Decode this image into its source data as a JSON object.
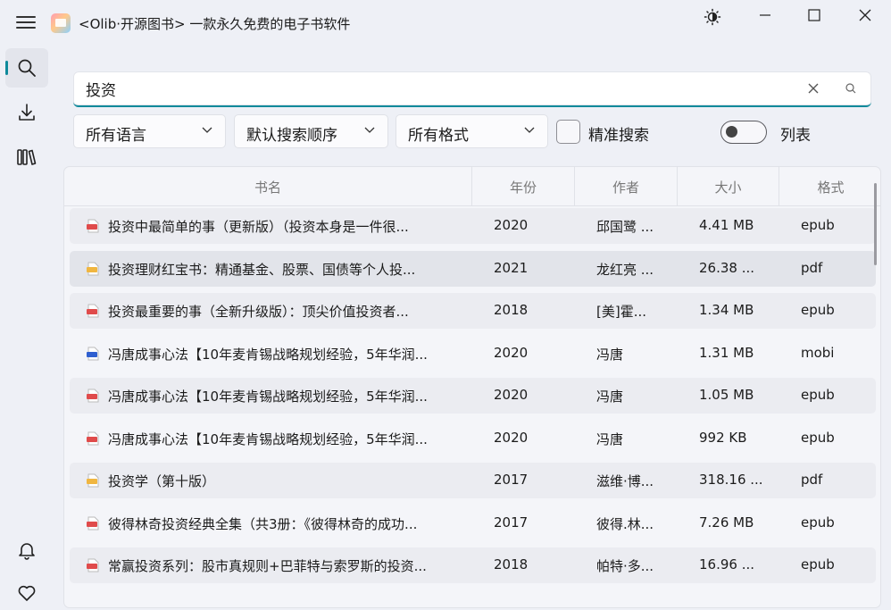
{
  "app": {
    "title": "<Olib·开源图书> 一款永久免费的电子书软件"
  },
  "search": {
    "query": "投资"
  },
  "filters": {
    "language": "所有语言",
    "order": "默认搜索顺序",
    "format": "所有格式",
    "exact_label": "精准搜索",
    "list_label": "列表",
    "exact_checked": false,
    "list_on": false
  },
  "table": {
    "headers": {
      "title": "书名",
      "year": "年份",
      "author": "作者",
      "size": "大小",
      "format": "格式"
    },
    "rows": [
      {
        "title": "投资中最简单的事（更新版）（投资本身是一件很...",
        "year": "2020",
        "author": "邱国鹭 ...",
        "size": "4.41 MB",
        "format": "epub",
        "icon": "epub-file-icon"
      },
      {
        "title": "投资理财红宝书：精通基金、股票、国债等个人投...",
        "year": "2021",
        "author": "龙红亮 ...",
        "size": "26.38 ...",
        "format": "pdf",
        "icon": "pdf-file-icon"
      },
      {
        "title": "投资最重要的事（全新升级版）：顶尖价值投资者...",
        "year": "2018",
        "author": "[美]霍...",
        "size": "1.34 MB",
        "format": "epub",
        "icon": "epub-file-icon"
      },
      {
        "title": "冯唐成事心法【10年麦肯锡战略规划经验，5年华润...",
        "year": "2020",
        "author": "冯唐",
        "size": "1.31 MB",
        "format": "mobi",
        "icon": "mobi-file-icon"
      },
      {
        "title": "冯唐成事心法【10年麦肯锡战略规划经验，5年华润...",
        "year": "2020",
        "author": "冯唐",
        "size": "1.05 MB",
        "format": "epub",
        "icon": "epub-file-icon"
      },
      {
        "title": "冯唐成事心法【10年麦肯锡战略规划经验，5年华润...",
        "year": "2020",
        "author": "冯唐",
        "size": "992 KB",
        "format": "epub",
        "icon": "epub-file-icon"
      },
      {
        "title": "投资学（第十版）",
        "year": "2017",
        "author": "滋维·博...",
        "size": "318.16 ...",
        "format": "pdf",
        "icon": "pdf-file-icon"
      },
      {
        "title": "彼得林奇投资经典全集（共3册：《彼得林奇的成功...",
        "year": "2017",
        "author": "彼得.林...",
        "size": "7.26 MB",
        "format": "epub",
        "icon": "epub-file-icon"
      },
      {
        "title": "常赢投资系列：股市真规则+巴菲特与索罗斯的投资...",
        "year": "2018",
        "author": "帕特·多...",
        "size": "16.96 ...",
        "format": "epub",
        "icon": "epub-file-icon"
      }
    ]
  },
  "colors": {
    "accent": "#0e8a9b",
    "epub": "#e04b4b",
    "pdf": "#f0b640",
    "mobi": "#2f5fd0"
  }
}
